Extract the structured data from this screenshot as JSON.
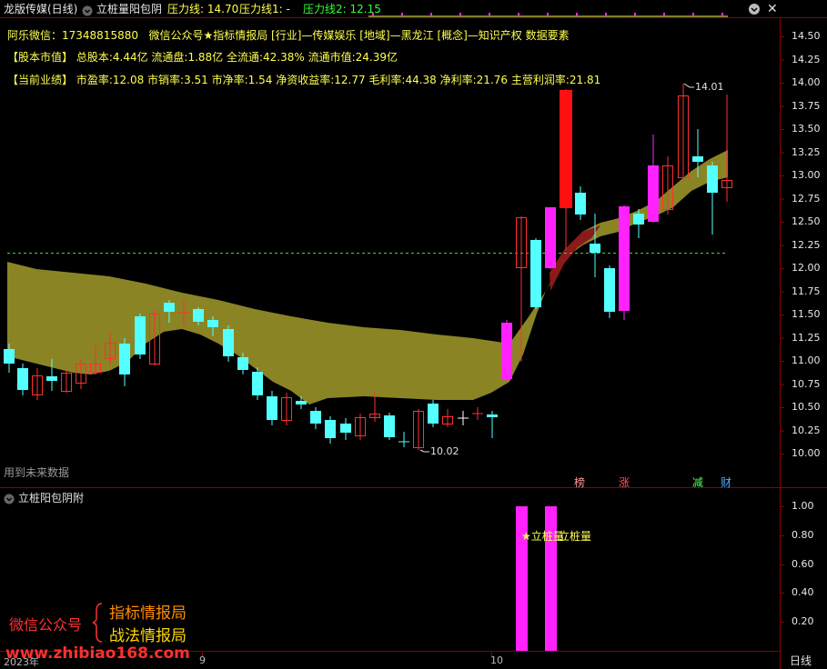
{
  "header": {
    "title": "龙版传媒(日线)",
    "indicator_name": "立桩量阳包阴",
    "pressure_label": "压力线: 14.70",
    "pressure1_label": "压力线1: -",
    "pressure2_label": "压力线2: 12.15"
  },
  "info": {
    "wechat": "阿乐微信：17348815880",
    "public_account": "微信公众号★指标情报局",
    "industry": "[行业]—传媒娱乐",
    "region": "[地域]—黑龙江",
    "concept": "[概念]—知识产权 数据要素",
    "market_cap_label": "【股本市值】",
    "market_cap_text": "总股本:4.44亿 流通盘:1.88亿 全流通:42.38% 流通市值:24.39亿",
    "perf_label": "【当前业绩】",
    "perf_text": "市盈率:12.08 市销率:3.51 市净率:1.54 净资收益率:12.77 毛利率:44.38 净利率:21.76 主营利润率:21.81"
  },
  "price_axis": [
    "14.50",
    "14.25",
    "14.00",
    "13.75",
    "13.50",
    "13.25",
    "13.00",
    "12.75",
    "12.50",
    "12.25",
    "12.00",
    "11.75",
    "11.50",
    "11.25",
    "11.00",
    "10.75",
    "10.50",
    "10.25",
    "10.00"
  ],
  "annotations": {
    "high_label": "14.01",
    "low_label": "10.02",
    "future_data_note": "用到未来数据",
    "tag_bang": "榜",
    "tag_zhang": "涨",
    "tag_jian": "减",
    "tag_cai": "财"
  },
  "sub_panel": {
    "title": "立桩阳包阴附",
    "axis": [
      "1.00",
      "0.80",
      "0.60",
      "0.40",
      "0.20"
    ],
    "signal_label_1": "★立桩量",
    "signal_label_2": "立桩量"
  },
  "watermark": {
    "account_label": "微信公众号",
    "line1": "指标情报局",
    "line2": "战法情报局",
    "url": "www.zhibiao168.com"
  },
  "time_axis": {
    "year_label": "2023年",
    "month_9": "9",
    "month_10": "10",
    "period": "日线"
  },
  "colors": {
    "up": "#ff3030",
    "down": "#54ffff",
    "magenta": "#ff22ff",
    "band": "#8a8424",
    "band_dark": "#8b1a1a",
    "accent": "#ffff50"
  }
}
